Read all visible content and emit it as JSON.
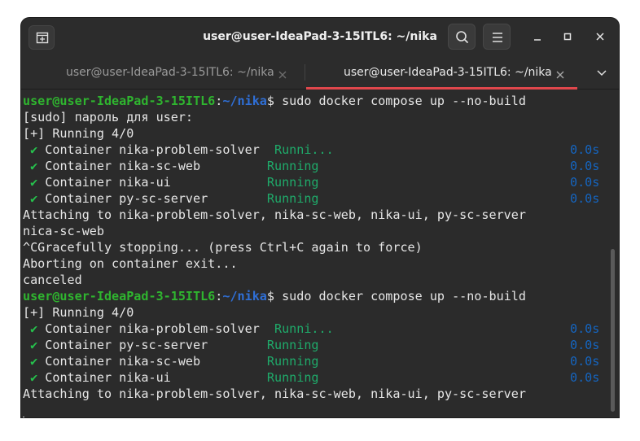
{
  "window": {
    "title": "user@user-IdeaPad-3-15ITL6: ~/nika"
  },
  "tabs": [
    {
      "label": "user@user-IdeaPad-3-15ITL6: ~/nika",
      "active": false
    },
    {
      "label": "user@user-IdeaPad-3-15ITL6: ~/nika",
      "active": true
    }
  ],
  "icons": {
    "new_tab": "new-tab-icon",
    "search": "search-icon",
    "menu": "hamburger-menu-icon",
    "minimize": "minimize-icon",
    "maximize": "maximize-icon",
    "close": "close-icon",
    "tab_close": "close-icon",
    "dropdown": "chevron-down-icon"
  },
  "colors": {
    "background": "#2b2b2b",
    "prompt_user": "#2fb52f",
    "prompt_path": "#2f6fd6",
    "check": "#26c24d",
    "status": "#1faa6a",
    "time": "#1565c0",
    "active_tab_underline": "#e0474c"
  },
  "terminal": {
    "prompt_user": "user@user-IdeaPad-3-15ITL6",
    "prompt_colon": ":",
    "prompt_path": "~/nika",
    "prompt_dollar": "$",
    "lines": {
      "l0_cmd": " sudo docker compose up --no-build",
      "l1": "[sudo] пароль для user:",
      "l2": "[+] Running 4/0",
      "l3_check": " ✔",
      "l3_name": " Container nika-problem-solver  ",
      "l3_status": "Runni...",
      "l3_time": "0.0s",
      "l4_check": " ✔",
      "l4_name": " Container nika-sc-web         ",
      "l4_status": "Running",
      "l4_time": "0.0s",
      "l5_check": " ✔",
      "l5_name": " Container nika-ui             ",
      "l5_status": "Running",
      "l5_time": "0.0s",
      "l6_check": " ✔",
      "l6_name": " Container py-sc-server        ",
      "l6_status": "Running",
      "l6_time": "0.0s",
      "l7": "Attaching to nika-problem-solver, nika-sc-web, nika-ui, py-sc-server",
      "l8": "nica-sc-web",
      "l9": "^CGracefully stopping... (press Ctrl+C again to force)",
      "l10": "Aborting on container exit...",
      "l11": "canceled",
      "l12_cmd": " sudo docker compose up --no-build",
      "l13": "[+] Running 4/0",
      "l14_check": " ✔",
      "l14_name": " Container nika-problem-solver  ",
      "l14_status": "Runni...",
      "l14_time": "0.0s",
      "l15_check": " ✔",
      "l15_name": " Container py-sc-server        ",
      "l15_status": "Running",
      "l15_time": "0.0s",
      "l16_check": " ✔",
      "l16_name": " Container nika-sc-web         ",
      "l16_status": "Running",
      "l16_time": "0.0s",
      "l17_check": " ✔",
      "l17_name": " Container nika-ui             ",
      "l17_status": "Running",
      "l17_time": "0.0s",
      "l18": "Attaching to nika-problem-solver, nika-sc-web, nika-ui, py-sc-server"
    }
  }
}
